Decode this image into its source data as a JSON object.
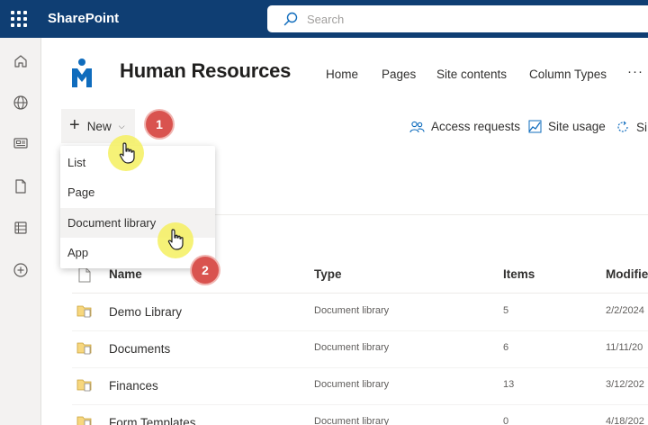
{
  "suite_bar": {
    "app_name": "SharePoint",
    "search_placeholder": "Search",
    "color": "#0f3e73"
  },
  "left_rail": {
    "icons": [
      "home-icon",
      "globe-icon",
      "news-icon",
      "document-icon",
      "list-icon",
      "add-circle-icon"
    ]
  },
  "site": {
    "title": "Human Resources",
    "nav": [
      "Home",
      "Pages",
      "Site contents",
      "Column Types"
    ],
    "nav_more": "···"
  },
  "command_bar": {
    "new_label": "New",
    "access_requests": "Access requests",
    "site_usage": "Site usage",
    "truncated_item": "Si"
  },
  "new_menu": {
    "items": [
      "List",
      "Page",
      "Document library",
      "App"
    ],
    "highlighted_index": 2
  },
  "annotations": {
    "step1": "1",
    "step2": "2",
    "badge_color": "#d9534f",
    "halo_color": "#f5f05f"
  },
  "table": {
    "headers": {
      "name": "Name",
      "type": "Type",
      "items": "Items",
      "modified": "Modifie"
    },
    "rows": [
      {
        "name": "Demo Library",
        "type": "Document library",
        "items": "5",
        "modified": "2/2/2024"
      },
      {
        "name": "Documents",
        "type": "Document library",
        "items": "6",
        "modified": "11/11/20"
      },
      {
        "name": "Finances",
        "type": "Document library",
        "items": "13",
        "modified": "3/12/202"
      },
      {
        "name": "Form Templates",
        "type": "Document library",
        "items": "0",
        "modified": "4/18/202"
      }
    ]
  }
}
